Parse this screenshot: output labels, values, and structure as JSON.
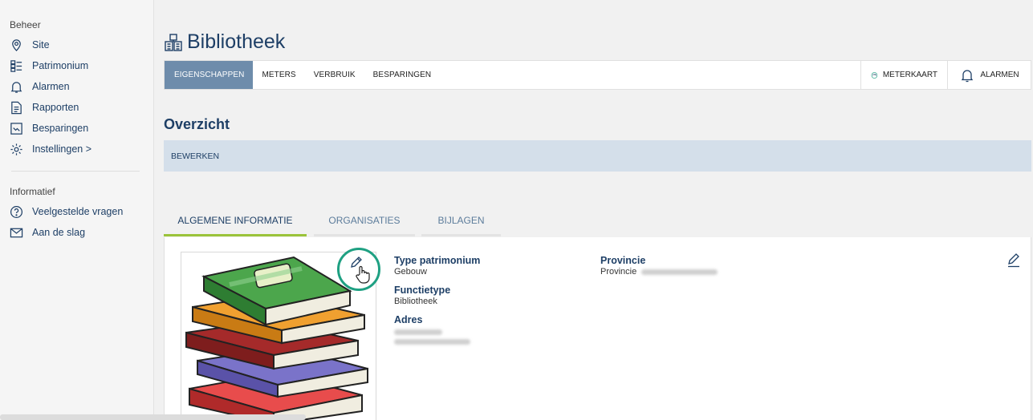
{
  "sidebar": {
    "beheer_heading": "Beheer",
    "beheer_items": [
      {
        "label": "Site",
        "icon": "location-pin-icon"
      },
      {
        "label": "Patrimonium",
        "icon": "list-grid-icon"
      },
      {
        "label": "Alarmen",
        "icon": "bell-icon"
      },
      {
        "label": "Rapporten",
        "icon": "document-icon"
      },
      {
        "label": "Besparingen",
        "icon": "savings-icon"
      },
      {
        "label": "Instellingen >",
        "icon": "gear-icon"
      }
    ],
    "info_heading": "Informatief",
    "info_items": [
      {
        "label": "Veelgestelde vragen",
        "icon": "question-circle-icon"
      },
      {
        "label": "Aan de slag",
        "icon": "envelope-icon"
      }
    ]
  },
  "header": {
    "title": "Bibliotheek",
    "icon": "building-icon"
  },
  "tabs": {
    "items": [
      "EIGENSCHAPPEN",
      "METERS",
      "VERBRUIK",
      "BESPARINGEN"
    ],
    "active": "EIGENSCHAPPEN",
    "meterkaart": "METERKAART",
    "alarmen": "ALARMEN"
  },
  "overview": {
    "title": "Overzicht",
    "edit_label": "BEWERKEN"
  },
  "subtabs": {
    "items": [
      "ALGEMENE INFORMATIE",
      "ORGANISATIES",
      "BIJLAGEN"
    ],
    "active": "ALGEMENE INFORMATIE"
  },
  "details": {
    "type_label": "Type patrimonium",
    "type_value": "Gebouw",
    "functie_label": "Functietype",
    "functie_value": "Bibliotheek",
    "adres_label": "Adres",
    "provincie_label": "Provincie",
    "provincie_value": "Provincie"
  },
  "colors": {
    "primary": "#1e3f66",
    "active_tab": "#6e8cab",
    "edit_bar": "#d4dfea",
    "subtab_active": "#9bc33a",
    "highlight": "#1ea082"
  }
}
